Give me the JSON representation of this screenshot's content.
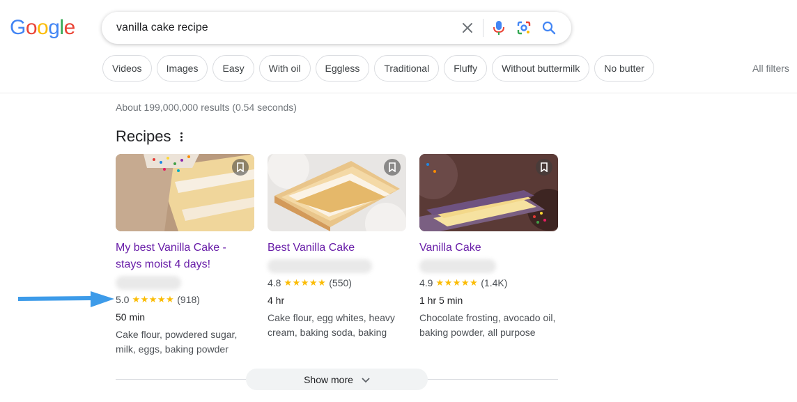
{
  "logo": {
    "letters": [
      "G",
      "o",
      "o",
      "g",
      "l",
      "e"
    ],
    "colors": [
      "#4285F4",
      "#EA4335",
      "#FBBC05",
      "#4285F4",
      "#34A853",
      "#EA4335"
    ]
  },
  "search": {
    "query": "vanilla cake recipe",
    "icons": [
      "close-icon",
      "mic-icon",
      "lens-icon",
      "search-icon"
    ]
  },
  "chips": [
    "Videos",
    "Images",
    "Easy",
    "With oil",
    "Eggless",
    "Traditional",
    "Fluffy",
    "Without buttermilk",
    "No butter"
  ],
  "all_filters": "All filters",
  "stats": "About 199,000,000 results (0.54 seconds)",
  "recipes": {
    "title": "Recipes",
    "cards": [
      {
        "title": "My best Vanilla Cake - stays moist 4 days!",
        "rating": "5.0",
        "stars": 5,
        "reviews": "(918)",
        "time": "50 min",
        "ingredients": "Cake flour, powdered sugar, milk, eggs, baking powder"
      },
      {
        "title": "Best Vanilla Cake",
        "rating": "4.8",
        "stars": 5,
        "reviews": "(550)",
        "time": "4 hr",
        "ingredients": "Cake flour, egg whites, heavy cream, baking soda, baking"
      },
      {
        "title": "Vanilla Cake",
        "rating": "4.9",
        "stars": 5,
        "reviews": "(1.4K)",
        "time": "1 hr 5 min",
        "ingredients": "Chocolate frosting, avocado oil, baking powder, all purpose"
      }
    ]
  },
  "show_more": "Show more",
  "colors": {
    "link_visited": "#681da8",
    "star": "#fbbc04",
    "arrow": "#3d9be9"
  }
}
